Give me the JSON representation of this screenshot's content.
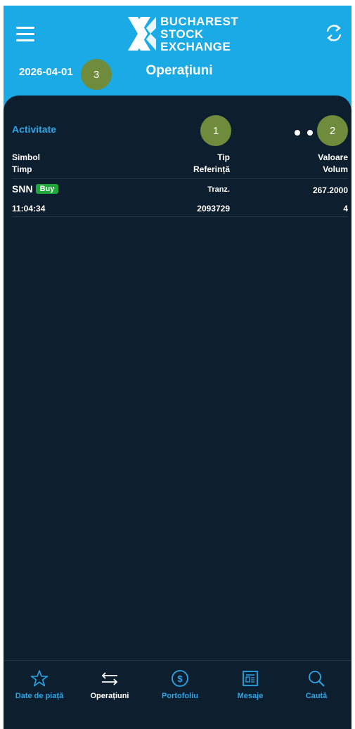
{
  "header": {
    "logo_lines": [
      "BUCHAREST",
      "STOCK",
      "EXCHANGE"
    ],
    "date": "2026-04-01",
    "title": "Operațiuni"
  },
  "annotations": [
    "1",
    "2",
    "3"
  ],
  "activity": {
    "title": "Activitate",
    "columns": {
      "left_top": "Simbol",
      "left_bottom": "Timp",
      "mid_top": "Tip",
      "mid_bottom": "Referință",
      "right_top": "Valoare",
      "right_bottom": "Volum"
    },
    "rows": [
      {
        "symbol": "SNN",
        "side": "Buy",
        "type": "Tranz.",
        "value": "267.2000",
        "time": "11:04:34",
        "reference": "2093729",
        "volume": "4"
      }
    ]
  },
  "tabs": [
    {
      "label": "Date de piață",
      "icon": "star-icon"
    },
    {
      "label": "Operațiuni",
      "icon": "transfer-arrows-icon"
    },
    {
      "label": "Portofoliu",
      "icon": "dollar-icon"
    },
    {
      "label": "Mesaje",
      "icon": "news-icon"
    },
    {
      "label": "Caută",
      "icon": "search-icon"
    }
  ],
  "colors": {
    "header": "#1aabe6",
    "background": "#0d1e2e",
    "accent": "#2aa6e6",
    "buy": "#1fa83a",
    "annotation": "#6e8c3c"
  }
}
